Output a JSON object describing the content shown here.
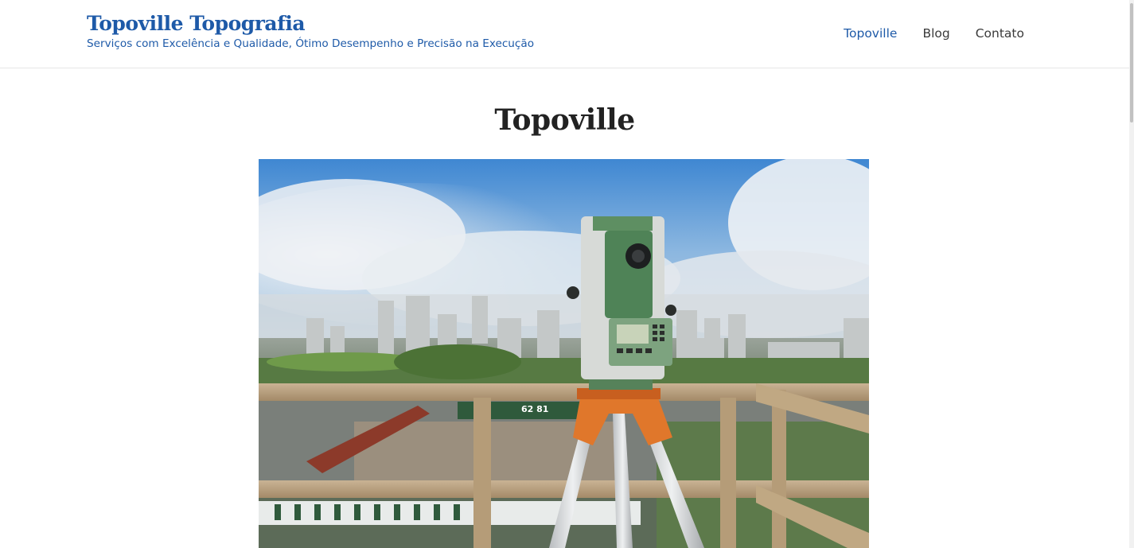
{
  "header": {
    "site_title": "Topoville Topografia",
    "tagline": "Serviços com Excelência e Qualidade, Ótimo Desempenho e Precisão na Execução"
  },
  "nav": {
    "items": [
      {
        "label": "Topoville",
        "active": true
      },
      {
        "label": "Blog",
        "active": false
      },
      {
        "label": "Contato",
        "active": false
      }
    ]
  },
  "main": {
    "page_title": "Topoville",
    "hero_image_text": "62 81"
  },
  "colors": {
    "brand": "#1e5aa8",
    "title": "#222222",
    "nav": "#3a3a3a"
  }
}
